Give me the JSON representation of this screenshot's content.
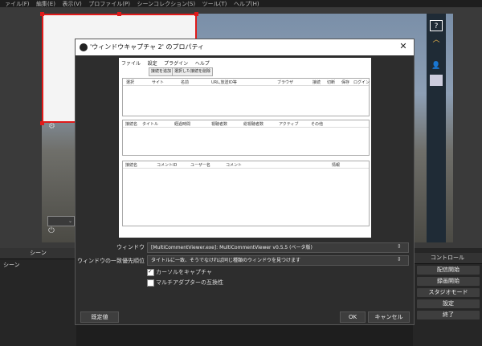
{
  "obs": {
    "menu": [
      "ァイル(F)",
      "編集(E)",
      "表示(V)",
      "プロファイル(P)",
      "シーンコレクション(S)",
      "ツール(T)",
      "ヘルプ(H)"
    ],
    "scene_panel_title": "シーン",
    "scene_item": "シーン",
    "controls": [
      "コントロール",
      "配信開始",
      "録画開始",
      "スタジオモード",
      "設定",
      "終了"
    ]
  },
  "dialog": {
    "title": "'ウィンドウキャプチャ 2' のプロパティ",
    "close": "✕",
    "plugin": {
      "menu": [
        "ファイル",
        "設定",
        "プラグイン",
        "ヘルプ"
      ],
      "buttons": [
        "接続を追加",
        "選択した接続を削除"
      ],
      "grid1_headers": [
        "選択",
        "サイト",
        "名前",
        "URL,放送ID等",
        "ブラウザ",
        "接続",
        "切断",
        "保存",
        "ログイン"
      ],
      "grid2_headers": [
        "接続名",
        "タイトル",
        "経過時間",
        "視聴者数",
        "総視聴者数",
        "アクティブ",
        "その他"
      ],
      "grid3_headers": [
        "接続名",
        "コメントID",
        "ユーザー名",
        "コメント",
        "情報"
      ]
    },
    "window_label": "ウィンドウ",
    "window_value": "[MultiCommentViewer.exe]: MultiCommentViewer v0.5.5 (ベータ版)",
    "priority_label": "ウィンドウの一致優先順位",
    "priority_value": "タイトルに一致、そうでなければ同じ種類のウィンドウを見つけます",
    "capture_cursor_label": "カーソルをキャプチャ",
    "multi_adapter_label": "マルチアダプターの互換性",
    "defaults_button": "既定値",
    "ok_button": "OK",
    "cancel_button": "キャンセル"
  }
}
